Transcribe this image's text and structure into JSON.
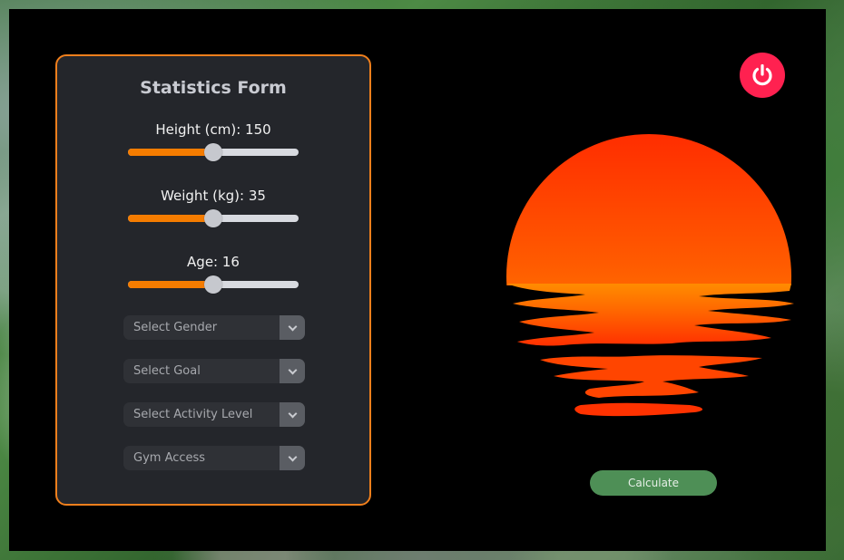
{
  "form": {
    "title": "Statistics Form",
    "sliders": [
      {
        "label": "Height (cm): 150",
        "fraction": 0.5
      },
      {
        "label": "Weight (kg): 35",
        "fraction": 0.5
      },
      {
        "label": "Age: 16",
        "fraction": 0.5
      }
    ],
    "dropdowns": [
      {
        "text": "Select Gender"
      },
      {
        "text": "Select Goal"
      },
      {
        "text": "Select Activity Level"
      },
      {
        "text": "Gym Access"
      }
    ]
  },
  "actions": {
    "calculate_label": "Calculate",
    "power_icon": "power-icon"
  },
  "colors": {
    "accent": "#f57c00",
    "card_border": "#f07f1c",
    "power": "#ff2150",
    "calculate": "#4e8f56",
    "sun_top": "#ff3000",
    "sun_bottom": "#ff8c00"
  }
}
